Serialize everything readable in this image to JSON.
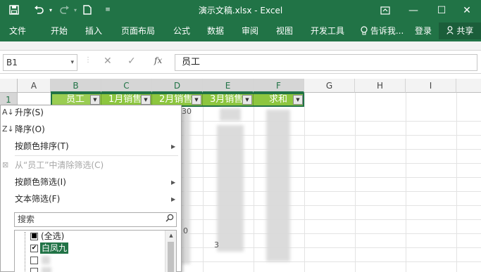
{
  "window": {
    "title": "演示文稿.xlsx - Excel",
    "qat": {
      "save_icon": "save-icon",
      "undo_icon": "undo-icon",
      "redo_icon": "redo-icon",
      "new_icon": "new-file-icon",
      "customize_icon": "chevron-down-icon"
    },
    "controls": {
      "restore_icon": "ribbon-display-icon",
      "minimize": "—",
      "maximize": "☐",
      "close": "✕"
    }
  },
  "ribbon": {
    "tabs": [
      "文件",
      "开始",
      "插入",
      "页面布局",
      "公式",
      "数据",
      "审阅",
      "视图",
      "开发工具"
    ],
    "tell_me": "告诉我...",
    "login": "登录",
    "share": "共享"
  },
  "formula_bar": {
    "name_box": "B1",
    "cancel": "✕",
    "enter": "✓",
    "fx": "fx",
    "value": "员工"
  },
  "sheet": {
    "columns": [
      "A",
      "B",
      "C",
      "D",
      "E",
      "F",
      "G",
      "H",
      "I"
    ],
    "rows": [
      "1"
    ],
    "headers": [
      "员工",
      "1月销售",
      "2月销售",
      "3月销售",
      "求和"
    ],
    "visible_fragments": {
      "d2": "30",
      "d9": "0",
      "e10": "3"
    }
  },
  "filter_menu": {
    "sort_asc": "升序(S)",
    "sort_desc": "降序(O)",
    "sort_by_color": "按颜色排序(T)",
    "clear_filter": "从“员工”中清除筛选(C)",
    "filter_by_color": "按颜色筛选(I)",
    "text_filter": "文本筛选(F)",
    "search_placeholder": "搜索",
    "items": [
      {
        "label": "(全选)",
        "state": "partial"
      },
      {
        "label": "白凤九",
        "state": "checked"
      }
    ]
  },
  "colors": {
    "excel_green": "#217346",
    "header_fill": "#8dc63f"
  }
}
